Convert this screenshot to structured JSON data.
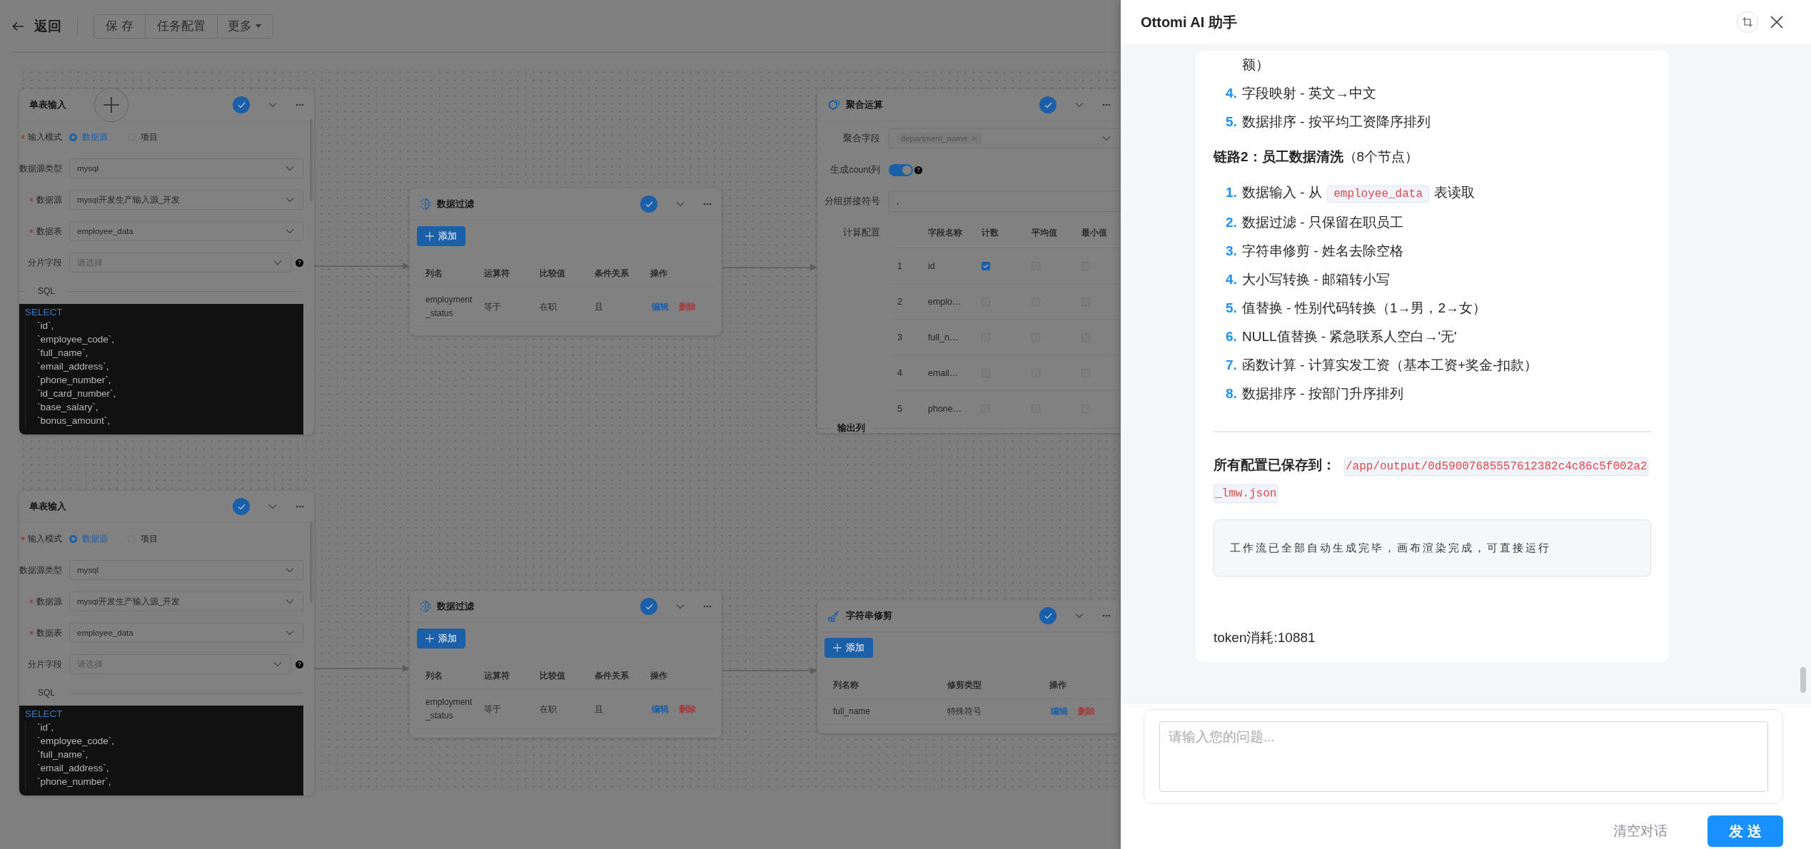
{
  "toolbar": {
    "back_label": "返回",
    "buttons": [
      "保 存",
      "任务配置"
    ],
    "more_label": "更多"
  },
  "canvas": {
    "nodes": [
      {
        "kind": "input",
        "title": "单表输入",
        "mode": {
          "label": "输入模式",
          "required": true,
          "options": [
            {
              "label": "数据源",
              "selected": true
            },
            {
              "label": "项目",
              "selected": false
            }
          ]
        },
        "fields": [
          {
            "label": "数据源类型",
            "required": false,
            "value": "mysql"
          },
          {
            "label": "数据源",
            "required": true,
            "value": "mysql开发生产输入源_开发"
          },
          {
            "label": "数据表",
            "required": true,
            "value": "employee_data"
          },
          {
            "label": "分片字段",
            "required": false,
            "placeholder": "请选择",
            "help": "?"
          }
        ],
        "sql_label": "SQL",
        "sql_lines": [
          "SELECT",
          "`id`,",
          "`employee_code`,",
          "`full_name`,",
          "`email_address`,",
          "`phone_number`,",
          "`id_card_number`,",
          "`base_salary`,",
          "`bonus_amount`,"
        ]
      },
      {
        "kind": "filter",
        "title": "数据过滤",
        "add_label": "添加",
        "columns": [
          "列名",
          "运算符",
          "比较值",
          "条件关系",
          "操作"
        ],
        "rows": [
          {
            "cells": [
              "employment_status",
              "等于",
              "在职",
              "且"
            ],
            "actions": [
              {
                "kind": "edit",
                "label": "编辑"
              },
              {
                "kind": "delete",
                "label": "删除"
              }
            ]
          }
        ]
      },
      {
        "kind": "aggregate",
        "title": "聚合运算",
        "group_field": {
          "label": "聚合字段",
          "tags": [
            "department_name"
          ]
        },
        "count_toggle": {
          "label": "生成count列",
          "on": true,
          "help": "?"
        },
        "separator": {
          "label": "分组拼接符号",
          "value": ","
        },
        "calc": {
          "label": "计算配置",
          "columns": [
            "字段名称",
            "计数",
            "平均值",
            "最小值"
          ],
          "rows": [
            {
              "index": "1",
              "field": "id",
              "checks": [
                true,
                false,
                false
              ]
            },
            {
              "index": "2",
              "field": "emplo…",
              "checks": [
                false,
                false,
                false
              ]
            },
            {
              "index": "3",
              "field": "full_n…",
              "checks": [
                false,
                false,
                false
              ]
            },
            {
              "index": "4",
              "field": "email…",
              "checks": [
                false,
                false,
                false
              ]
            },
            {
              "index": "5",
              "field": "phone…",
              "checks": [
                false,
                false,
                false
              ]
            }
          ]
        },
        "output_label": "输出列"
      },
      {
        "kind": "input",
        "title": "单表输入",
        "mode": {
          "label": "输入模式",
          "required": true,
          "options": [
            {
              "label": "数据源",
              "selected": true
            },
            {
              "label": "项目",
              "selected": false
            }
          ]
        },
        "fields": [
          {
            "label": "数据源类型",
            "required": false,
            "value": "mysql"
          },
          {
            "label": "数据源",
            "required": true,
            "value": "mysql开发生产输入源_开发"
          },
          {
            "label": "数据表",
            "required": true,
            "value": "employee_data"
          },
          {
            "label": "分片字段",
            "required": false,
            "placeholder": "请选择",
            "help": "?"
          }
        ],
        "sql_label": "SQL",
        "sql_lines": [
          "SELECT",
          "`id`,",
          "`employee_code`,",
          "`full_name`,",
          "`email_address`,",
          "`phone_number`,"
        ]
      },
      {
        "kind": "filter",
        "title": "数据过滤",
        "add_label": "添加",
        "columns": [
          "列名",
          "运算符",
          "比较值",
          "条件关系",
          "操作"
        ],
        "rows": [
          {
            "cells": [
              "employment_status",
              "等于",
              "在职",
              "且"
            ],
            "actions": [
              {
                "kind": "edit",
                "label": "编辑"
              },
              {
                "kind": "delete",
                "label": "删除"
              }
            ]
          }
        ]
      },
      {
        "kind": "trim",
        "title": "字符串修剪",
        "add_label": "添加",
        "columns": [
          "列名称",
          "修剪类型",
          "操作"
        ],
        "rows": [
          {
            "cells": [
              "full_name",
              "特殊符号"
            ],
            "actions": [
              {
                "kind": "edit",
                "label": "编辑"
              },
              {
                "kind": "delete",
                "label": "删除"
              }
            ]
          }
        ]
      }
    ]
  },
  "assistant": {
    "title": "Ottomi AI 助手",
    "message": {
      "continuation": "额）",
      "list_a": [
        {
          "num": "4.",
          "segments": [
            {
              "kind": "text",
              "text": "字段映射 - 英文→中文"
            }
          ]
        },
        {
          "num": "5.",
          "segments": [
            {
              "kind": "text",
              "text": "数据排序 - 按平均工资降序排列"
            }
          ]
        }
      ],
      "heading": "**链路2：员工数据清洗**（8个节点）",
      "list_b": [
        {
          "num": "1.",
          "segments": [
            {
              "kind": "text",
              "text": "数据输入 - 从"
            },
            {
              "kind": "code",
              "text": "employee_data"
            },
            {
              "kind": "text",
              "text": "表读取"
            }
          ]
        },
        {
          "num": "2.",
          "segments": [
            {
              "kind": "text",
              "text": "数据过滤 - 只保留在职员工"
            }
          ]
        },
        {
          "num": "3.",
          "segments": [
            {
              "kind": "text",
              "text": "字符串修剪 - 姓名去除空格"
            }
          ]
        },
        {
          "num": "4.",
          "segments": [
            {
              "kind": "text",
              "text": "大小写转换 - 邮箱转小写"
            }
          ]
        },
        {
          "num": "5.",
          "segments": [
            {
              "kind": "text",
              "text": "值替换 - 性别代码转换（1→男，2→女）"
            }
          ]
        },
        {
          "num": "6.",
          "segments": [
            {
              "kind": "text",
              "text": "NULL值替换 - 紧急联系人空白→'无'"
            }
          ]
        },
        {
          "num": "7.",
          "segments": [
            {
              "kind": "text",
              "text": "函数计算 - 计算实发工资（基本工资+奖金-扣款）"
            }
          ]
        },
        {
          "num": "8.",
          "segments": [
            {
              "kind": "text",
              "text": "数据排序 - 按部门升序排列"
            }
          ]
        }
      ],
      "saved": {
        "label": "所有配置已保存到：",
        "path": "/app/output/0d59007685557612382c4c86c5f002a2_lmw.json"
      },
      "note": "工作流已全部自动生成完毕，画布渲染完成，可直接运行",
      "tokens": "token消耗:10881"
    },
    "input": {
      "placeholder": "请输入您的问题..."
    },
    "clear_label": "清空对话",
    "send_label": "发 送"
  }
}
